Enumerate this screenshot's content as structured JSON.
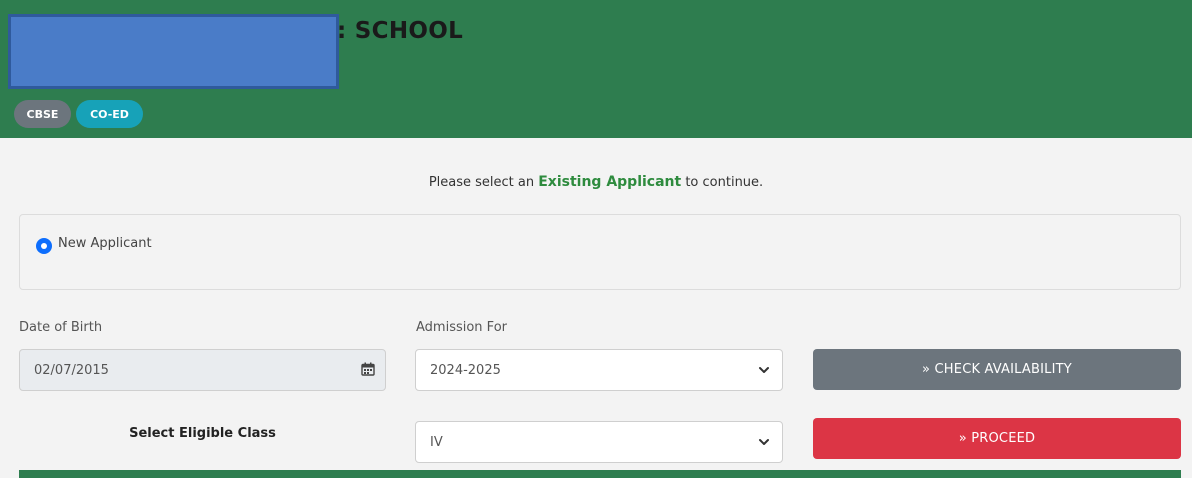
{
  "header": {
    "school_title": ": SCHOOL",
    "tags": [
      "CBSE",
      "CO-ED"
    ],
    "colors": {
      "header_bg": "#2e7d4f",
      "redaction": "#4a7cc8"
    }
  },
  "prompt": {
    "before": "Please select an ",
    "highlight": "Existing Applicant",
    "after": " to continue."
  },
  "applicant": {
    "option_label": "New Applicant",
    "selected": true
  },
  "form": {
    "dob_label": "Date of Birth",
    "dob_value": "02/07/2015",
    "admission_label": "Admission For",
    "admission_value": "2024-2025",
    "eligible_class_label": "Select Eligible Class",
    "class_value": "IV",
    "check_button": "» CHECK AVAILABILITY",
    "proceed_button": "» PROCEED"
  },
  "icons": {
    "calendar": "calendar-icon",
    "dropdown": "chevron-down-icon",
    "radio": "radio-selected-icon"
  },
  "colors": {
    "check_btn": "#6c757d",
    "proceed_btn": "#dc3545",
    "co_ed_tag": "#17a2b8",
    "cbse_tag": "#6c757d",
    "highlight_text": "#2e8b3e"
  }
}
